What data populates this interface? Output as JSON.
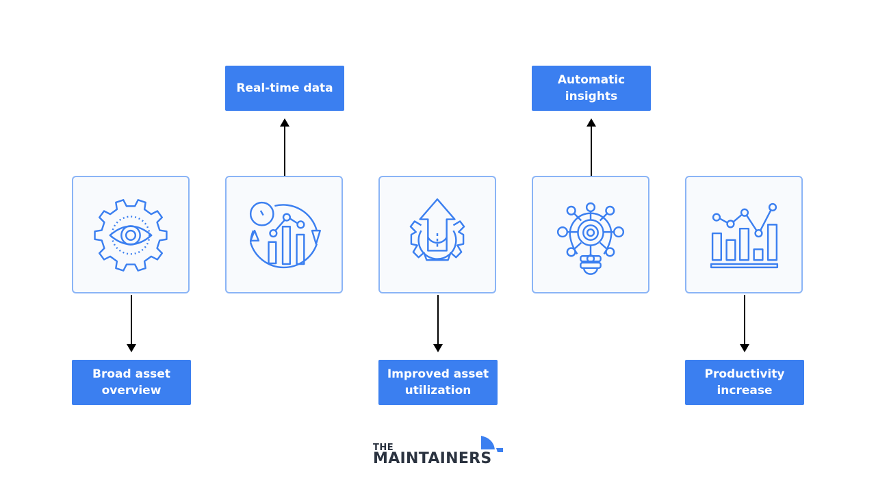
{
  "theme": {
    "accent": "#3b7ff0",
    "card_border": "#8ab4f6",
    "card_bg": "#f8fafd",
    "icon": "#3b7ff0",
    "arrow": "#000000",
    "logo_text": "#2b3340"
  },
  "nodes": [
    {
      "id": "overview",
      "icon": "gear-eye-icon",
      "label": "Broad asset overview",
      "direction": "down"
    },
    {
      "id": "realtime",
      "icon": "clock-chart-cycle-icon",
      "label": "Real-time data",
      "direction": "up"
    },
    {
      "id": "utilization",
      "icon": "gear-arrow-up-icon",
      "label": "Improved asset utilization",
      "direction": "down"
    },
    {
      "id": "insights",
      "icon": "lightbulb-network-icon",
      "label": "Automatic insights",
      "direction": "up"
    },
    {
      "id": "productivity",
      "icon": "bar-line-chart-icon",
      "label": "Productivity increase",
      "direction": "down"
    }
  ],
  "logo": {
    "line1": "THE",
    "line2": "MAINTAINERS"
  }
}
